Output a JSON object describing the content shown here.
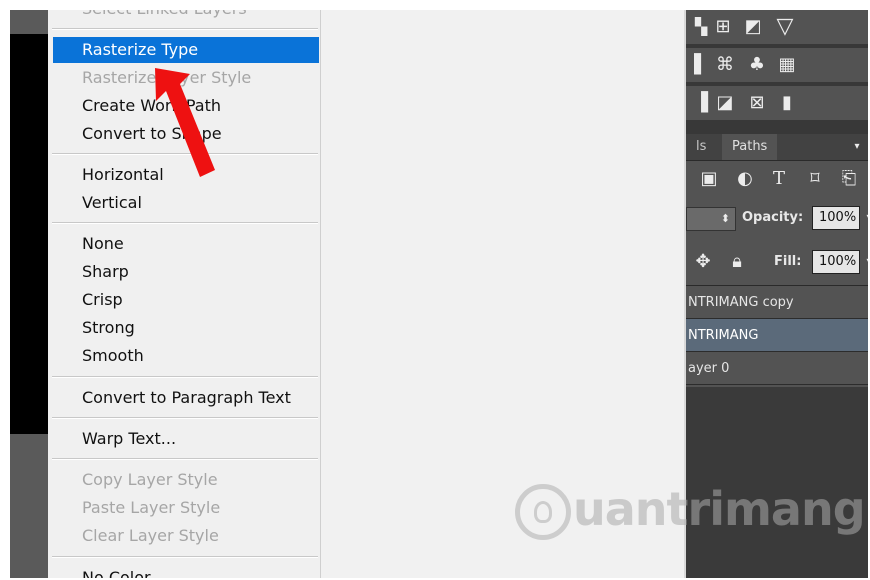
{
  "menu": {
    "items": [
      {
        "label": "Select Linked Layers",
        "disabled": true
      },
      {
        "label": "Rasterize Type",
        "disabled": false,
        "selected": true
      },
      {
        "label": "Rasterize Layer Style",
        "disabled": true
      },
      {
        "label": "Create Work Path",
        "disabled": false
      },
      {
        "label": "Convert to Shape",
        "disabled": false
      },
      {
        "label": "Horizontal",
        "disabled": false
      },
      {
        "label": "Vertical",
        "disabled": false
      },
      {
        "label": "None",
        "disabled": false
      },
      {
        "label": "Sharp",
        "disabled": false
      },
      {
        "label": "Crisp",
        "disabled": false
      },
      {
        "label": "Strong",
        "disabled": false
      },
      {
        "label": "Smooth",
        "disabled": false
      },
      {
        "label": "Convert to Paragraph Text",
        "disabled": false
      },
      {
        "label": "Warp Text...",
        "disabled": false
      },
      {
        "label": "Copy Layer Style",
        "disabled": true
      },
      {
        "label": "Paste Layer Style",
        "disabled": true
      },
      {
        "label": "Clear Layer Style",
        "disabled": true
      },
      {
        "label": "No Color",
        "disabled": false
      }
    ],
    "selected_color": "#0a73d8",
    "disabled_color": "#a6a6a6"
  },
  "panel": {
    "tabs": {
      "partial": "ls",
      "paths": "Paths"
    },
    "opacity_label": "Opacity:",
    "opacity_value": "100%",
    "fill_label": "Fill:",
    "fill_value": "100%",
    "layers": [
      {
        "name": "NTRIMANG copy",
        "active": false
      },
      {
        "name": "NTRIMANG",
        "active": true
      },
      {
        "name": "ayer 0",
        "active": false
      }
    ]
  },
  "watermark": {
    "text": "uantrimang"
  },
  "annotation": {
    "arrow_color": "#ee1111"
  }
}
